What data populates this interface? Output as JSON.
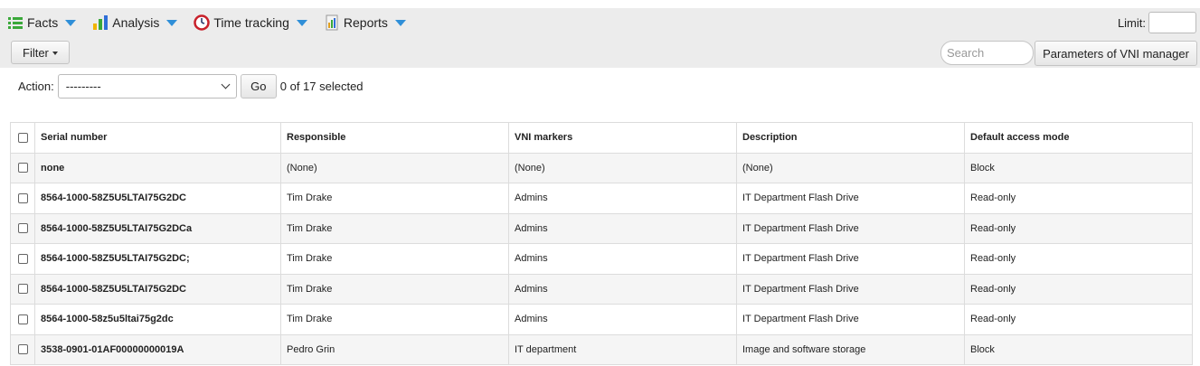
{
  "menubar": {
    "items": [
      {
        "label": "Facts",
        "icon": "list-icon"
      },
      {
        "label": "Analysis",
        "icon": "bar-chart-icon"
      },
      {
        "label": "Time tracking",
        "icon": "clock-icon"
      },
      {
        "label": "Reports",
        "icon": "report-icon"
      }
    ],
    "accent": "#2f8fd8"
  },
  "limit": {
    "label": "Limit:",
    "value": ""
  },
  "filter": {
    "label": "Filter"
  },
  "search": {
    "placeholder": "Search"
  },
  "parameters_button": {
    "label": "Parameters of VNI manager"
  },
  "action": {
    "label": "Action:",
    "selected": "---------",
    "go_label": "Go",
    "selection_status": "0 of 17 selected"
  },
  "table": {
    "columns": [
      "Serial number",
      "Responsible",
      "VNI markers",
      "Description",
      "Default access mode"
    ],
    "rows": [
      {
        "serial": "none",
        "responsible": "(None)",
        "markers": "(None)",
        "description": "(None)",
        "access": "Block"
      },
      {
        "serial": "8564-1000-58Z5U5LTAI75G2DC",
        "responsible": "Tim Drake",
        "markers": "Admins",
        "description": "IT Department Flash Drive",
        "access": "Read-only"
      },
      {
        "serial": "8564-1000-58Z5U5LTAI75G2DCa",
        "responsible": "Tim Drake",
        "markers": "Admins",
        "description": "IT Department Flash Drive",
        "access": "Read-only"
      },
      {
        "serial": "8564-1000-58Z5U5LTAI75G2DC;",
        "responsible": "Tim Drake",
        "markers": "Admins",
        "description": "IT Department Flash Drive",
        "access": "Read-only"
      },
      {
        "serial": "8564-1000-58Z5U5LTAI75G2DC",
        "responsible": "Tim Drake",
        "markers": "Admins",
        "description": "IT Department Flash Drive",
        "access": "Read-only"
      },
      {
        "serial": "8564-1000-58z5u5ltai75g2dc",
        "responsible": "Tim Drake",
        "markers": "Admins",
        "description": "IT Department Flash Drive",
        "access": "Read-only"
      },
      {
        "serial": "3538-0901-01AF00000000019A",
        "responsible": "Pedro Grin",
        "markers": "IT department",
        "description": "Image and software storage",
        "access": "Block"
      }
    ]
  }
}
